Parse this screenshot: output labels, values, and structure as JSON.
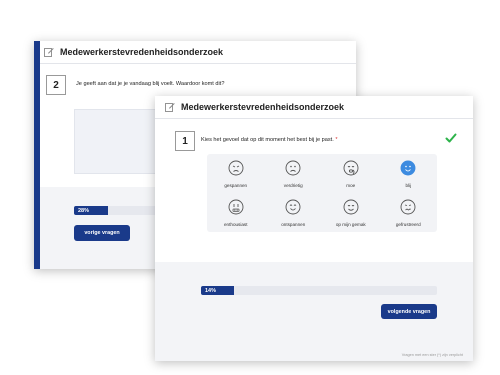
{
  "survey_title": "Medewerkerstevredenheidsonderzoek",
  "back_card": {
    "question_number": "2",
    "question_text": "Je geeft aan dat je je vandaag blij voelt. Waardoor komt dit?",
    "progress_label": "28%",
    "progress_value": 0.28,
    "prev_button": "vorige vragen"
  },
  "front_card": {
    "question_number": "1",
    "question_text": "Kies het gevoel dat op dit moment het best bij je past.",
    "required_marker": "*",
    "emotions": [
      {
        "label": "gespannen",
        "icon": "tense-face-icon",
        "selected": false
      },
      {
        "label": "verdrietig",
        "icon": "sad-face-icon",
        "selected": false
      },
      {
        "label": "moe",
        "icon": "tired-face-icon",
        "selected": false
      },
      {
        "label": "blij",
        "icon": "happy-face-icon",
        "selected": true
      },
      {
        "label": "enthousiast",
        "icon": "excited-face-icon",
        "selected": false
      },
      {
        "label": "ontspannen",
        "icon": "relaxed-face-icon",
        "selected": false
      },
      {
        "label": "op mijn gemak",
        "icon": "content-face-icon",
        "selected": false
      },
      {
        "label": "gefrustreerd",
        "icon": "frustrated-face-icon",
        "selected": false
      }
    ],
    "progress_label": "14%",
    "progress_value": 0.14,
    "next_button": "volgende vragen",
    "footnote": "Vragen met een ster (*) zijn verplicht"
  },
  "colors": {
    "navy": "#1a3a8a",
    "selected_blue": "#3d8be0",
    "check_green": "#2db34a",
    "panel_grey": "#f2f3f6"
  }
}
